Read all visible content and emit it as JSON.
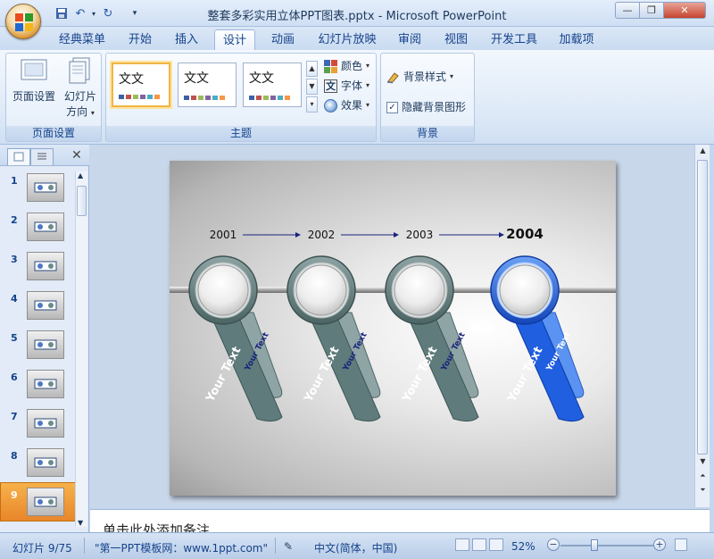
{
  "titlebar": {
    "title": "整套多彩实用立体PPT图表.pptx - Microsoft PowerPoint",
    "qat": [
      "save-icon",
      "undo-icon",
      "redo-icon",
      "customize-icon"
    ]
  },
  "tabs": [
    "经典菜单",
    "开始",
    "插入",
    "设计",
    "动画",
    "幻灯片放映",
    "审阅",
    "视图",
    "开发工具",
    "加载项"
  ],
  "active_tab": "设计",
  "ribbon": {
    "page_setup": {
      "label": "页面设置",
      "btn_page_setup": "页面设置",
      "btn_orientation_line1": "幻灯片",
      "btn_orientation_line2": "方向"
    },
    "themes": {
      "label": "主题",
      "thumb_text": "文文",
      "colors": "颜色",
      "fonts": "字体",
      "effects": "效果"
    },
    "background": {
      "label": "背景",
      "styles": "背景样式",
      "hide_graphics": "隐藏背景图形",
      "hide_checked": true
    }
  },
  "slides": {
    "numbers": [
      "1",
      "2",
      "3",
      "4",
      "5",
      "6",
      "7",
      "8",
      "9"
    ],
    "selected": "9"
  },
  "slide": {
    "years": [
      "2001",
      "2002",
      "2003",
      "2004"
    ],
    "highlight_year": "2004",
    "pin_main_text": "Your Text",
    "pin_sub_text": "Your Text",
    "colors": {
      "gray": "#5f7b7b",
      "blue": "#1f5fe0",
      "light_blue": "#5b93f2"
    }
  },
  "notes": {
    "placeholder": "单击此处添加备注"
  },
  "status": {
    "slide": "幻灯片 9/75",
    "theme": "\"第一PPT模板网：www.1ppt.com\"",
    "lang": "中文(简体，中国)",
    "zoom": "52%",
    "zoom_percent": 52
  }
}
